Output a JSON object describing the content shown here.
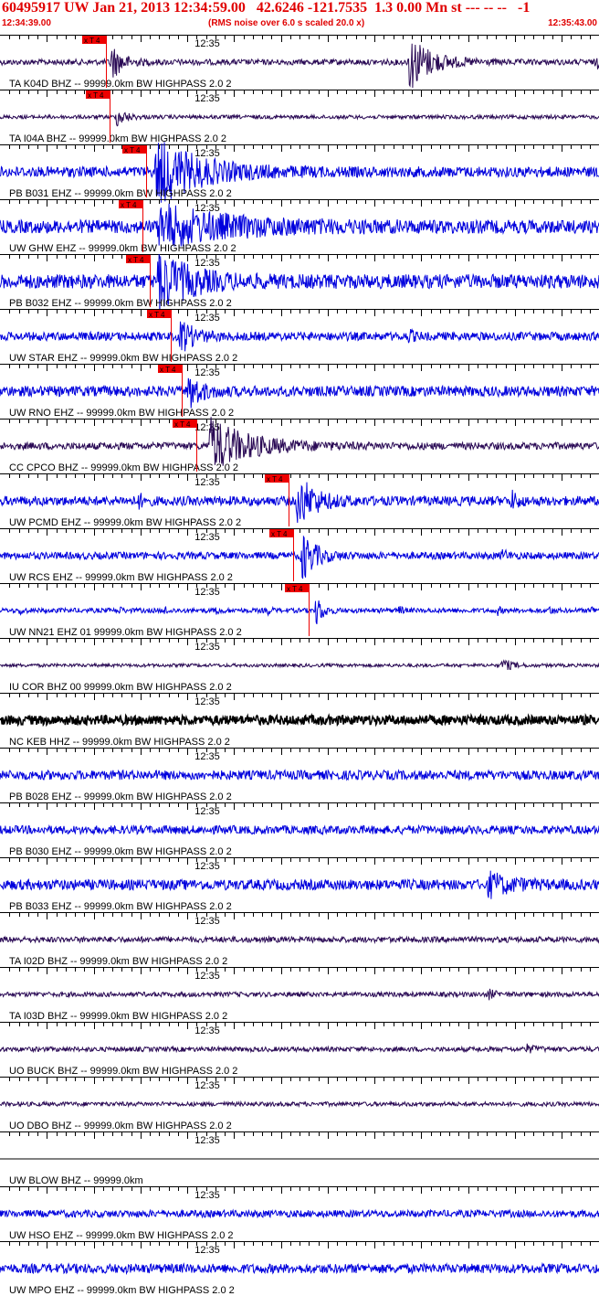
{
  "header": {
    "title": "60495917 UW Jan 21, 2013 12:34:59.00   42.6246 -121.7535  1.3 0.00 Mn st --- -- --   -1",
    "start_time": "12:34:39.00",
    "end_time": "12:35:43.00",
    "note": "(RMS noise over 6.0 s scaled 20.0 x)"
  },
  "colors": {
    "trace_blue": "#0000dd",
    "trace_dark": "#2a0a55",
    "trace_black": "#000000",
    "pick_red": "#ee0000",
    "title_red": "#e00000"
  },
  "chart_data": {
    "type": "line",
    "x_range_seconds": [
      0,
      64
    ],
    "minute_label": "12:35",
    "minute_label_seconds": 21,
    "pick_label": "x T 4",
    "series": [
      {
        "name": "TA K04D BHZ -- 99999.0km BW  HIGHPASS  2.0  2",
        "color": "dark",
        "noise": 0.12,
        "pick_s": 11.3,
        "events": [
          {
            "t": 11.7,
            "amp": 0.9,
            "dur": 2.5
          },
          {
            "t": 43.5,
            "amp": 1.3,
            "dur": 5
          },
          {
            "t": 63.5,
            "amp": 0.35,
            "dur": 1.2
          }
        ]
      },
      {
        "name": "TA I04A BHZ -- 99999.0km BW  HIGHPASS  2.0  2",
        "color": "dark",
        "noise": 0.08,
        "pick_s": 11.7,
        "events": [
          {
            "t": 12.3,
            "amp": 0.5,
            "dur": 2
          }
        ]
      },
      {
        "name": "PB B031 EHZ -- 99999.0km BW  HIGHPASS  2.0  2",
        "color": "blue",
        "noise": 0.22,
        "pick_s": 15.6,
        "events": [
          {
            "t": 16.5,
            "amp": 1.4,
            "dur": 10
          }
        ]
      },
      {
        "name": "UW GHW EHZ -- 99999.0km BW  HIGHPASS  2.0  2",
        "color": "blue",
        "noise": 0.28,
        "pick_s": 15.2,
        "events": [
          {
            "t": 16.8,
            "amp": 0.85,
            "dur": 16
          }
        ]
      },
      {
        "name": "PB B032 EHZ -- 99999.0km BW  HIGHPASS  2.0  2",
        "color": "blue",
        "noise": 0.3,
        "pick_s": 16.0,
        "events": [
          {
            "t": 16.7,
            "amp": 1.3,
            "dur": 7
          }
        ]
      },
      {
        "name": "UW STAR EHZ -- 99999.0km BW  HIGHPASS  2.0  2",
        "color": "blue",
        "noise": 0.18,
        "pick_s": 18.2,
        "events": [
          {
            "t": 19.1,
            "amp": 0.8,
            "dur": 3
          },
          {
            "t": 43.5,
            "amp": 0.35,
            "dur": 1
          }
        ]
      },
      {
        "name": "UW RNO EHZ -- 99999.0km BW  HIGHPASS  2.0  2",
        "color": "blue",
        "noise": 0.22,
        "pick_s": 19.4,
        "events": [
          {
            "t": 20.0,
            "amp": 0.9,
            "dur": 2.5
          }
        ]
      },
      {
        "name": "CC CPCO BHZ -- 99999.0km BW  HIGHPASS  2.0  2",
        "color": "dark",
        "noise": 0.15,
        "pick_s": 21.0,
        "events": [
          {
            "t": 22.2,
            "amp": 1.2,
            "dur": 9
          }
        ]
      },
      {
        "name": "UW PCMD EHZ -- 99999.0km BW  HIGHPASS  2.0  2",
        "color": "blue",
        "noise": 0.2,
        "pick_s": 30.8,
        "events": [
          {
            "t": 31.6,
            "amp": 1.2,
            "dur": 4
          },
          {
            "t": 14.5,
            "amp": 0.4,
            "dur": 1.2
          },
          {
            "t": 54.5,
            "amp": 0.45,
            "dur": 1.5
          }
        ]
      },
      {
        "name": "UW RCS EHZ -- 99999.0km BW  HIGHPASS  2.0  2",
        "color": "blue",
        "noise": 0.15,
        "pick_s": 31.3,
        "events": [
          {
            "t": 32.0,
            "amp": 1.3,
            "dur": 3
          },
          {
            "t": 53.5,
            "amp": 0.35,
            "dur": 1
          }
        ]
      },
      {
        "name": "UW NN21 EHZ 01 99999.0km BW  HIGHPASS  2.0  2",
        "color": "blue",
        "noise": 0.1,
        "pick_s": 33.0,
        "events": [
          {
            "t": 33.6,
            "amp": 0.9,
            "dur": 1.5
          },
          {
            "t": 2.0,
            "amp": 0.35,
            "dur": 0.6
          },
          {
            "t": 12.5,
            "amp": 0.35,
            "dur": 0.6
          },
          {
            "t": 17.5,
            "amp": 0.35,
            "dur": 0.6
          },
          {
            "t": 23.0,
            "amp": 0.35,
            "dur": 0.6
          },
          {
            "t": 28.5,
            "amp": 0.35,
            "dur": 0.6
          },
          {
            "t": 42.5,
            "amp": 0.35,
            "dur": 0.6
          },
          {
            "t": 53.0,
            "amp": 0.35,
            "dur": 0.6
          },
          {
            "t": 58.5,
            "amp": 0.35,
            "dur": 0.6
          },
          {
            "t": 63.0,
            "amp": 0.35,
            "dur": 0.6
          }
        ]
      },
      {
        "name": "IU COR BHZ 00 99999.0km BW  HIGHPASS  2.0  2",
        "color": "dark",
        "noise": 0.07,
        "pick_s": null,
        "events": [
          {
            "t": 53.5,
            "amp": 0.35,
            "dur": 2
          }
        ]
      },
      {
        "name": "NC KEB HHZ -- 99999.0km BW  HIGHPASS  2.0  2",
        "color": "black",
        "noise": 0.2,
        "pick_s": null,
        "events": []
      },
      {
        "name": "PB B028 EHZ -- 99999.0km BW  HIGHPASS  2.0  2",
        "color": "blue",
        "noise": 0.2,
        "pick_s": null,
        "events": []
      },
      {
        "name": "PB B030 EHZ -- 99999.0km BW  HIGHPASS  2.0  2",
        "color": "blue",
        "noise": 0.18,
        "pick_s": null,
        "events": []
      },
      {
        "name": "PB B033 EHZ -- 99999.0km BW  HIGHPASS  2.0  2",
        "color": "blue",
        "noise": 0.22,
        "pick_s": null,
        "events": [
          {
            "t": 52.0,
            "amp": 0.5,
            "dur": 5
          }
        ]
      },
      {
        "name": "TA I02D BHZ -- 99999.0km BW  HIGHPASS  2.0  2",
        "color": "dark",
        "noise": 0.12,
        "pick_s": null,
        "events": []
      },
      {
        "name": "TA I03D BHZ -- 99999.0km BW  HIGHPASS  2.0  2",
        "color": "dark",
        "noise": 0.1,
        "pick_s": null,
        "events": [
          {
            "t": 52.0,
            "amp": 0.25,
            "dur": 1.5
          }
        ]
      },
      {
        "name": "UO BUCK BHZ -- 99999.0km BW  HIGHPASS  2.0  2",
        "color": "dark",
        "noise": 0.1,
        "pick_s": null,
        "events": [
          {
            "t": 56.0,
            "amp": 0.2,
            "dur": 2
          }
        ]
      },
      {
        "name": "UO DBO BHZ -- 99999.0km BW  HIGHPASS  2.0  2",
        "color": "dark",
        "noise": 0.09,
        "pick_s": null,
        "events": []
      },
      {
        "name": "UW BLOW BHZ -- 99999.0km",
        "color": "black",
        "noise": 0,
        "pick_s": null,
        "events": []
      },
      {
        "name": "UW HSO EHZ -- 99999.0km BW  HIGHPASS  2.0  2",
        "color": "blue",
        "noise": 0.15,
        "pick_s": null,
        "events": []
      },
      {
        "name": "UW MPO EHZ -- 99999.0km BW  HIGHPASS  2.0  2",
        "color": "blue",
        "noise": 0.2,
        "pick_s": null,
        "events": []
      }
    ]
  }
}
